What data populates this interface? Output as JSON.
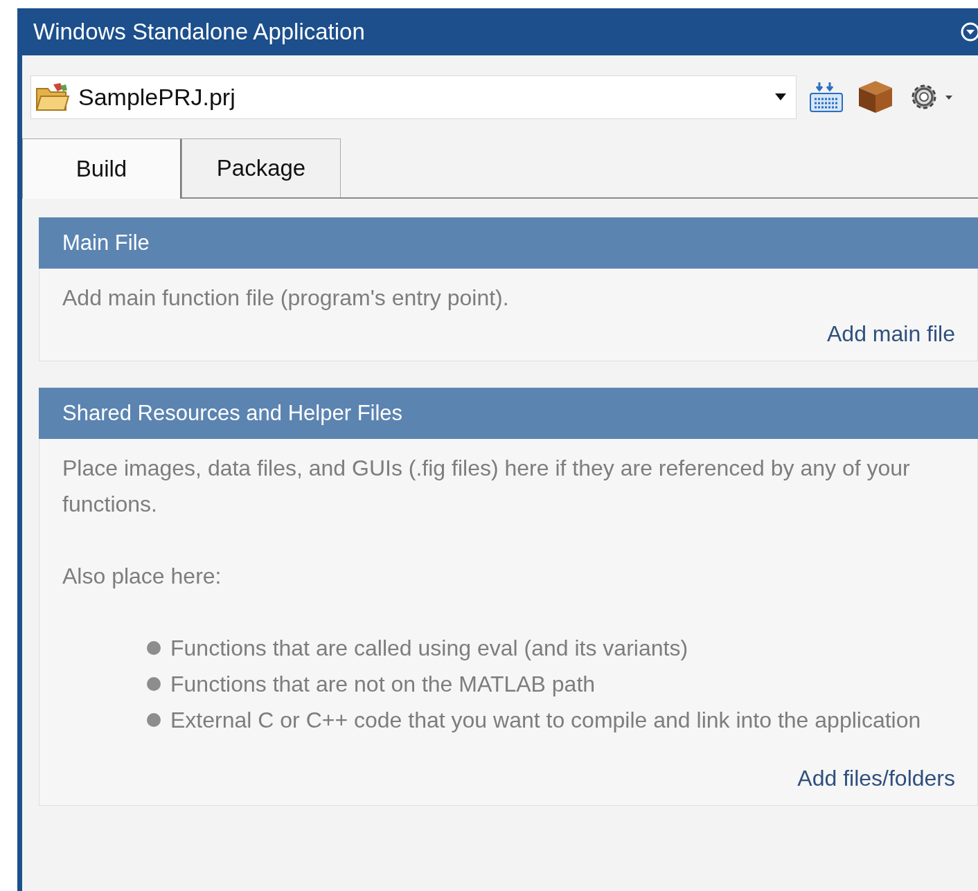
{
  "window": {
    "title": "Windows Standalone Application"
  },
  "project": {
    "value": "SamplePRJ.prj"
  },
  "tabs": [
    {
      "label": "Build",
      "selected": true
    },
    {
      "label": "Package",
      "selected": false
    }
  ],
  "sections": [
    {
      "title": "Main File",
      "paragraphs": [
        "Add main function file (program's entry point)."
      ],
      "action": "Add main file"
    },
    {
      "title": "Shared Resources and Helper Files",
      "paragraphs": [
        "Place images, data files, and GUIs (.fig files) here if they are referenced by any of your functions.",
        "Also place here:"
      ],
      "bullets": [
        "Functions that are called using eval (and its variants)",
        "Functions that are not on the MATLAB path",
        "External C or C++ code that you want to compile and link into the application"
      ],
      "action": "Add files/folders"
    }
  ]
}
